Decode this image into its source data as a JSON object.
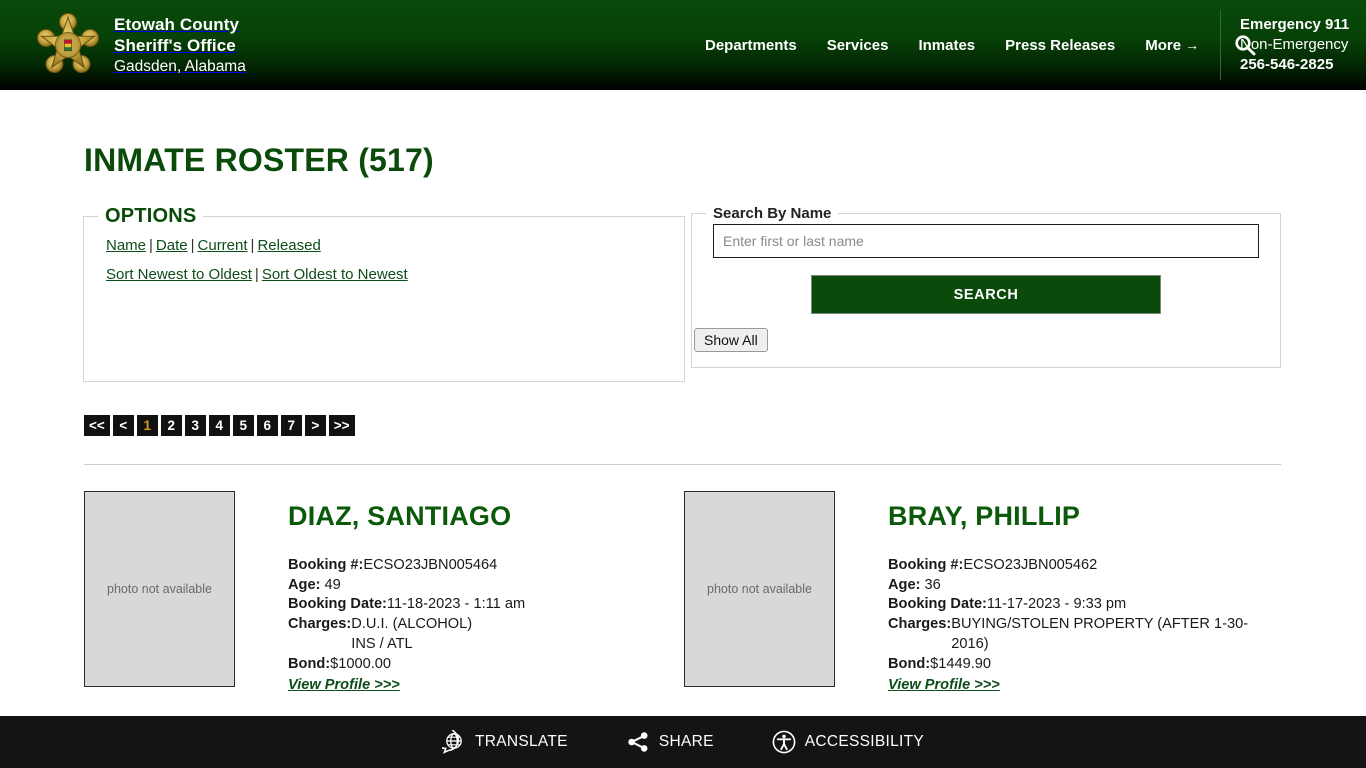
{
  "header": {
    "brand": {
      "line1": "Etowah County",
      "line2": "Sheriff's Office",
      "line3": "Gadsden, Alabama",
      "badge_icon": "sheriff-star-badge-icon"
    },
    "nav": [
      {
        "label": "Departments"
      },
      {
        "label": "Services"
      },
      {
        "label": "Inmates"
      },
      {
        "label": "Press Releases"
      },
      {
        "label": "More",
        "arrow": "→"
      }
    ],
    "search_icon": "search-icon",
    "emergency": {
      "line1": "Emergency 911",
      "line2": "Non-Emergency",
      "line3": "256-546-2825"
    },
    "colors": {
      "green": "#0a4a0a",
      "black": "#000000"
    }
  },
  "main": {
    "title": "INMATE ROSTER (517)",
    "options": {
      "legend": "OPTIONS",
      "row1": [
        {
          "label": "Name"
        },
        {
          "label": "Date"
        },
        {
          "label": "Current"
        },
        {
          "label": "Released"
        }
      ],
      "row2": [
        {
          "label": "Sort Newest to Oldest"
        },
        {
          "label": "Sort Oldest to Newest"
        }
      ],
      "separator": "|"
    },
    "search": {
      "legend": "Search By Name",
      "placeholder": "Enter first or last name",
      "value": "",
      "submit_label": "SEARCH",
      "show_all_label": "Show All"
    },
    "pagination": {
      "items": [
        "<<",
        "<",
        "1",
        "2",
        "3",
        "4",
        "5",
        "6",
        "7",
        ">",
        ">>"
      ],
      "active": "1",
      "active_color": "#d99a1a"
    },
    "labels": {
      "booking": "Booking #:",
      "age": "Age:",
      "booking_date": "Booking Date:",
      "charges": "Charges:",
      "bond": "Bond:",
      "view_profile": "View Profile >>>",
      "photo_placeholder": "photo not available"
    },
    "records": [
      {
        "name": "DIAZ, SANTIAGO",
        "booking_number": "ECSO23JBN005464",
        "age": "49",
        "booking_date": "11-18-2023 - 1:11 am",
        "charges": "D.U.I. (ALCOHOL)\nINS / ATL",
        "bond": "$1000.00"
      },
      {
        "name": "BRAY, PHILLIP",
        "booking_number": "ECSO23JBN005462",
        "age": "36",
        "booking_date": "11-17-2023 - 9:33 pm",
        "charges": "BUYING/STOLEN PROPERTY (AFTER 1-30-2016)",
        "bond": "$1449.90"
      }
    ]
  },
  "footer": {
    "items": [
      {
        "label": "TRANSLATE",
        "icon": "globe-speech-bubble-icon"
      },
      {
        "label": "SHARE",
        "icon": "share-nodes-icon"
      },
      {
        "label": "ACCESSIBILITY",
        "icon": "accessibility-person-icon"
      }
    ]
  }
}
